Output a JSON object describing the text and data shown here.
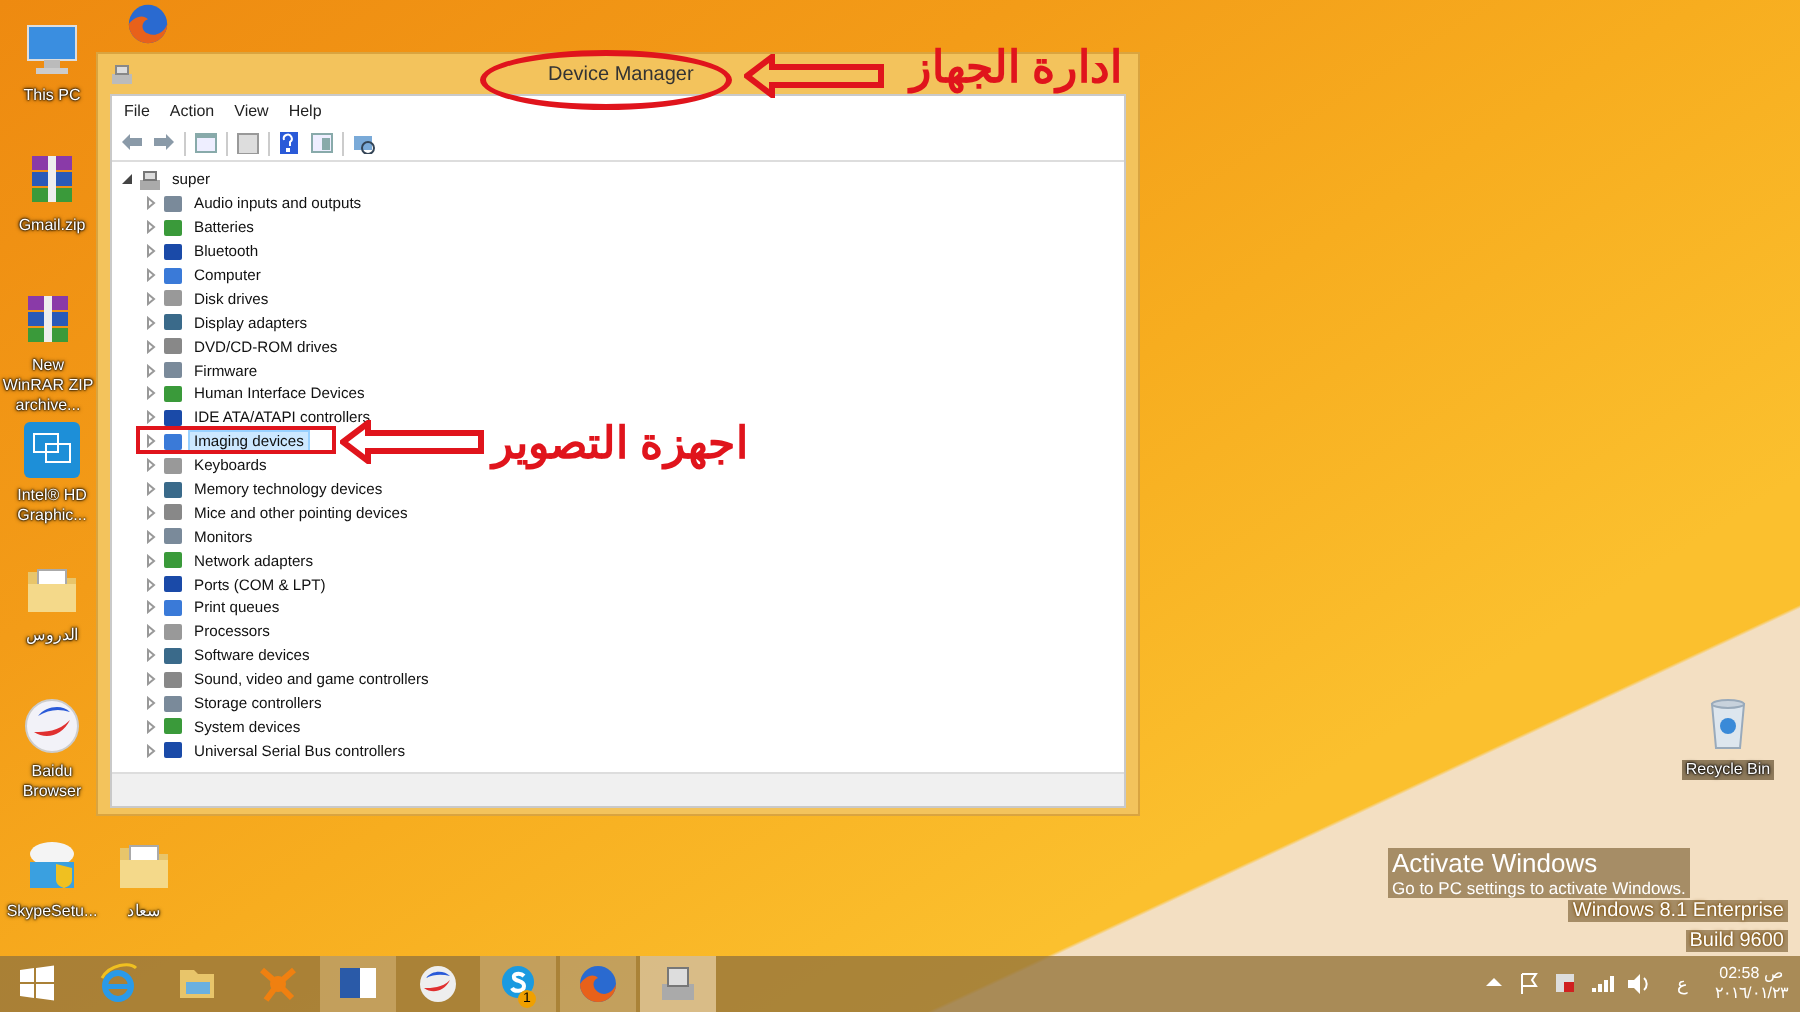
{
  "desktop_icons": [
    {
      "kind": "pc",
      "label": "This PC"
    },
    {
      "kind": "firefox"
    },
    {
      "kind": "archive",
      "label": "Gmail.zip"
    },
    {
      "kind": "archive",
      "label": "New WinRAR ZIP archive..."
    },
    {
      "kind": "intel",
      "label": "Intel® HD Graphic..."
    },
    {
      "kind": "folder",
      "label": "الدروس"
    },
    {
      "kind": "baidu",
      "label": "Baidu Browser"
    },
    {
      "kind": "setup",
      "label": "SkypeSetu..."
    },
    {
      "kind": "folder",
      "label": "سعاد"
    },
    {
      "kind": "recycle",
      "label": "Recycle Bin"
    }
  ],
  "window": {
    "title": "Device Manager",
    "menu": [
      "File",
      "Action",
      "View",
      "Help"
    ],
    "tree": {
      "label": "super",
      "expanded": true,
      "children": [
        {
          "label": "Audio inputs and outputs",
          "selected": false
        },
        {
          "label": "Batteries",
          "selected": false
        },
        {
          "label": "Bluetooth",
          "selected": false
        },
        {
          "label": "Computer",
          "selected": false
        },
        {
          "label": "Disk drives",
          "selected": false
        },
        {
          "label": "Display adapters",
          "selected": false
        },
        {
          "label": "DVD/CD-ROM drives",
          "selected": false
        },
        {
          "label": "Firmware",
          "selected": false
        },
        {
          "label": "Human Interface Devices",
          "selected": false
        },
        {
          "label": "IDE ATA/ATAPI controllers",
          "selected": false
        },
        {
          "label": "Imaging devices",
          "selected": true
        },
        {
          "label": "Keyboards",
          "selected": false
        },
        {
          "label": "Memory technology devices",
          "selected": false
        },
        {
          "label": "Mice and other pointing devices",
          "selected": false
        },
        {
          "label": "Monitors",
          "selected": false
        },
        {
          "label": "Network adapters",
          "selected": false
        },
        {
          "label": "Ports (COM & LPT)",
          "selected": false
        },
        {
          "label": "Print queues",
          "selected": false
        },
        {
          "label": "Processors",
          "selected": false
        },
        {
          "label": "Software devices",
          "selected": false
        },
        {
          "label": "Sound, video and game controllers",
          "selected": false
        },
        {
          "label": "Storage controllers",
          "selected": false
        },
        {
          "label": "System devices",
          "selected": false
        },
        {
          "label": "Universal Serial Bus controllers",
          "selected": false
        }
      ]
    }
  },
  "annotations": [
    {
      "kind": "title",
      "text": "ادارة الجهاز"
    },
    {
      "kind": "item",
      "text": "اجهزة التصوير"
    }
  ],
  "activation_notice": {
    "title": "Activate Windows",
    "text": "Go to PC settings to activate Windows."
  },
  "edition": [
    "Windows 8.1 Enterprise",
    "Build 9600"
  ],
  "taskbar": {
    "apps": [
      {
        "kind": "start",
        "running": false,
        "selected": false
      },
      {
        "kind": "ie",
        "running": false,
        "selected": false
      },
      {
        "kind": "explorer",
        "running": false,
        "selected": false
      },
      {
        "kind": "avast",
        "running": false,
        "selected": false
      },
      {
        "kind": "word",
        "running": true,
        "selected": false
      },
      {
        "kind": "baidu",
        "running": false,
        "selected": false
      },
      {
        "kind": "skype",
        "running": true,
        "selected": false,
        "badge": "1"
      },
      {
        "kind": "firefox",
        "running": true,
        "selected": false
      },
      {
        "kind": "devmgr",
        "running": true,
        "selected": true
      }
    ],
    "tray": {
      "language": "ع",
      "time": "02:58 ص",
      "date": "٢٠١٦/٠١/٢٣"
    }
  }
}
